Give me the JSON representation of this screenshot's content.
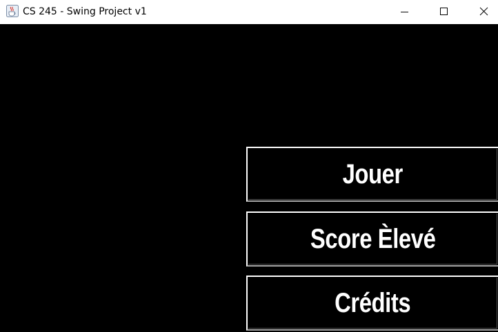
{
  "window": {
    "title": "CS 245 - Swing Project v1",
    "icon": "java-coffee-cup-icon",
    "controls": {
      "minimize": "minimize-icon",
      "maximize": "maximize-icon",
      "close": "close-icon"
    }
  },
  "menu": {
    "background_color": "#000000",
    "text_color": "#ffffff",
    "buttons": [
      {
        "label": "Jouer"
      },
      {
        "label": "Score Èlevé"
      },
      {
        "label": "Crédits"
      }
    ]
  }
}
